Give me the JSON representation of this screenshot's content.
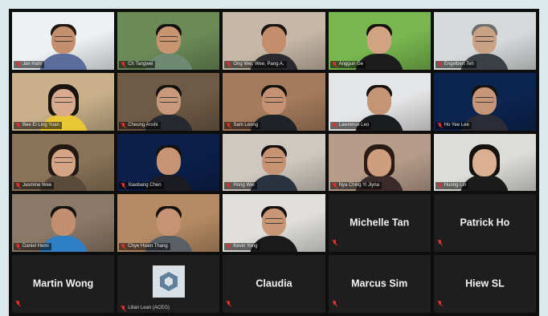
{
  "participants_video": [
    {
      "name": "Jan Hahl",
      "bg": "#eef1f4",
      "skin": "#c48f6c",
      "hair": "#201612",
      "shirt": "#5b6d9c",
      "glasses": true,
      "long": false
    },
    {
      "name": "Ch Tangwei",
      "bg": "#6a8a57",
      "skin": "#c89570",
      "hair": "#15110e",
      "shirt": "#6f8a72",
      "glasses": true,
      "long": false,
      "active": true
    },
    {
      "name": "Ong Wei, Wee, Pang A.",
      "bg": "#c6b7a6",
      "skin": "#c48e6c",
      "hair": "#1a1410",
      "shirt": "#2a2a2e",
      "glasses": false,
      "long": false
    },
    {
      "name": "Anggun Ge",
      "bg": "#78b64e",
      "skin": "#d2a382",
      "hair": "#15110d",
      "shirt": "#1c1c1c",
      "glasses": false,
      "long": false
    },
    {
      "name": "Engelbert Teh",
      "bg": "#d7dadb",
      "skin": "#c9a184",
      "hair": "#6e6e6e",
      "shirt": "#3b3f46",
      "glasses": true,
      "long": false
    },
    {
      "name": "Bee Ei Ling Yuan",
      "bg": "#c9b08a",
      "skin": "#d9aa8d",
      "hair": "#1a1410",
      "shirt": "#e9c636",
      "glasses": true,
      "long": true
    },
    {
      "name": "Cheung Anshi",
      "bg": "#6f5a45",
      "skin": "#c89a7b",
      "hair": "#15110e",
      "shirt": "#25282e",
      "glasses": true,
      "long": false
    },
    {
      "name": "Sam Leong",
      "bg": "#a47b5c",
      "skin": "#c49273",
      "hair": "#15110e",
      "shirt": "#1f2227",
      "glasses": true,
      "long": false
    },
    {
      "name": "Lawrence Leo",
      "bg": "#e4e5e6",
      "skin": "#c49474",
      "hair": "#15110e",
      "shirt": "#1b1c20",
      "glasses": false,
      "long": false
    },
    {
      "name": "Ho Yee Lee",
      "bg": "#0c2450",
      "skin": "#c59677",
      "hair": "#15110e",
      "shirt": "#2a2d35",
      "glasses": true,
      "long": false
    },
    {
      "name": "Jasmine Wee",
      "bg": "#8a7358",
      "skin": "#d5a585",
      "hair": "#241813",
      "shirt": "#5a4a3a",
      "glasses": true,
      "long": true
    },
    {
      "name": "Xiaobang Chen",
      "bg": "#0b1f4a",
      "skin": "#c89574",
      "hair": "#15110e",
      "shirt": "#1b1b22",
      "glasses": false,
      "long": false
    },
    {
      "name": "Hong Wei",
      "bg": "#cfc8c0",
      "skin": "#c79373",
      "hair": "#15110e",
      "shirt": "#2a3340",
      "glasses": true,
      "long": false
    },
    {
      "name": "Nya Ching Yi Jiyna",
      "bg": "#b69c89",
      "skin": "#cf9e7f",
      "hair": "#2a1b14",
      "shirt": "#3a2a2a",
      "glasses": false,
      "long": true
    },
    {
      "name": "Huong Lin",
      "bg": "#dcdcd8",
      "skin": "#dbb091",
      "hair": "#15110e",
      "shirt": "#1b1b1b",
      "glasses": false,
      "long": true
    },
    {
      "name": "Daniel Hemi",
      "bg": "#8c7867",
      "skin": "#c29071",
      "hair": "#15110e",
      "shirt": "#2f7fc4",
      "glasses": false,
      "long": false
    },
    {
      "name": "Chye Hsien Thang",
      "bg": "#b58b63",
      "skin": "#c79372",
      "hair": "#15110e",
      "shirt": "#5a5f66",
      "glasses": false,
      "long": false
    },
    {
      "name": "Kevin Yong",
      "bg": "#e0dfdc",
      "skin": "#c99676",
      "hair": "#15110e",
      "shirt": "#1a1a1a",
      "glasses": true,
      "long": false
    }
  ],
  "participants_name_only": [
    {
      "display_name": "Michelle Tan"
    },
    {
      "display_name": "Patrick Ho"
    },
    {
      "display_name": "Martin Wong"
    },
    {
      "display_name": "Claudia"
    },
    {
      "display_name": "Marcus Sim"
    },
    {
      "display_name": "Hiew SL"
    }
  ],
  "avatar_participant": {
    "name": "Lilian Lean (ACEG)",
    "icon": "hexagon-logo-icon"
  },
  "colors": {
    "active_speaker_border": "#b7d433",
    "muted_mic": "#e0312f",
    "tile_bg": "#1e1e1e",
    "grid_bg": "#0e0e0e"
  }
}
